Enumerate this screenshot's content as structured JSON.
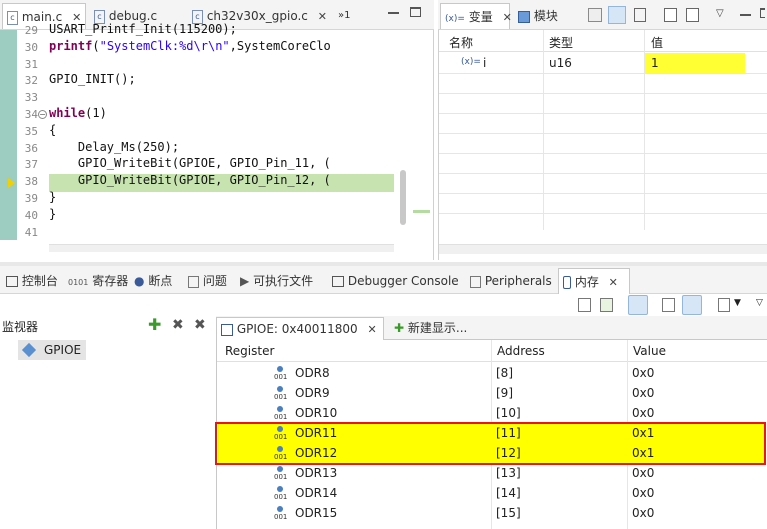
{
  "editor": {
    "tabs": [
      {
        "label": "main.c",
        "close": "✕"
      },
      {
        "label": "debug.c"
      },
      {
        "label": "ch32v30x_gpio.c",
        "close": "✕"
      },
      {
        "label": "»1"
      }
    ],
    "lines": [
      {
        "num": "29",
        "code": "USART_Printf_Init(115200);"
      },
      {
        "num": "30",
        "code": "printf(\"SystemClk:%d\\r\\n\",SystemCoreClo"
      },
      {
        "num": "31",
        "code": ""
      },
      {
        "num": "32",
        "code": "GPIO_INIT();"
      },
      {
        "num": "33",
        "code": ""
      },
      {
        "num": "34",
        "code": "while(1)"
      },
      {
        "num": "35",
        "code": "{"
      },
      {
        "num": "36",
        "code": "    Delay_Ms(250);"
      },
      {
        "num": "37",
        "code": "    GPIO_WriteBit(GPIOE, GPIO_Pin_11, ("
      },
      {
        "num": "38",
        "code": "    GPIO_WriteBit(GPIOE, GPIO_Pin_12, ("
      },
      {
        "num": "39",
        "code": "}"
      },
      {
        "num": "40",
        "code": "}"
      },
      {
        "num": "41",
        "code": ""
      }
    ]
  },
  "variables": {
    "tabs": [
      {
        "label": "变量",
        "prefix": "(x)=",
        "close": "✕"
      },
      {
        "label": "模块"
      }
    ],
    "columns": [
      "名称",
      "类型",
      "值"
    ],
    "rows": [
      {
        "name": "i",
        "prefix": "(x)=",
        "type": "u16",
        "value": "1"
      }
    ]
  },
  "bottom_tabs": [
    {
      "label": "控制台"
    },
    {
      "label": "寄存器"
    },
    {
      "label": "断点"
    },
    {
      "label": "问题"
    },
    {
      "label": "可执行文件"
    },
    {
      "label": "Debugger Console"
    },
    {
      "label": "Peripherals"
    },
    {
      "label": "内存",
      "close": "✕"
    }
  ],
  "monitors": {
    "title": "监视器",
    "items": [
      {
        "label": "GPIOE"
      }
    ]
  },
  "memory": {
    "tabs": [
      {
        "label": "GPIOE: 0x40011800",
        "close": "✕"
      },
      {
        "label": "新建显示..."
      }
    ],
    "columns": [
      "Register",
      "Address",
      "Value"
    ],
    "rows": [
      {
        "name": "ODR8",
        "address": "[8]",
        "value": "0x0"
      },
      {
        "name": "ODR9",
        "address": "[9]",
        "value": "0x0"
      },
      {
        "name": "ODR10",
        "address": "[10]",
        "value": "0x0"
      },
      {
        "name": "ODR11",
        "address": "[11]",
        "value": "0x1"
      },
      {
        "name": "ODR12",
        "address": "[12]",
        "value": "0x1"
      },
      {
        "name": "ODR13",
        "address": "[13]",
        "value": "0x0"
      },
      {
        "name": "ODR14",
        "address": "[14]",
        "value": "0x0"
      },
      {
        "name": "ODR15",
        "address": "[15]",
        "value": "0x0"
      }
    ],
    "highlight_color": "#ffff00",
    "annotation_color": "#e8161c"
  }
}
